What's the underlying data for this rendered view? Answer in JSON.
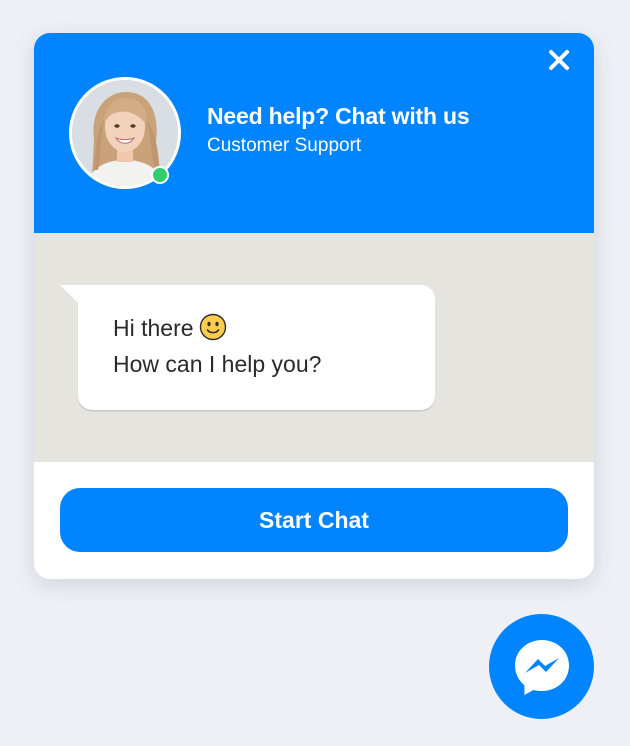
{
  "header": {
    "title": "Need help? Chat with us",
    "subtitle": "Customer Support",
    "close_icon": "close-icon",
    "avatar": "agent-avatar",
    "status": "online"
  },
  "chat": {
    "message_line1": "Hi there",
    "message_emoji": "slightly-smiling-face-icon",
    "message_line2": "How can I help you?"
  },
  "footer": {
    "start_label": "Start Chat"
  },
  "launcher": {
    "icon": "messenger-icon"
  },
  "colors": {
    "brand": "#0084ff",
    "page_background": "#eef0f5",
    "chat_background": "#e6e4df",
    "online": "#31cc6b"
  }
}
